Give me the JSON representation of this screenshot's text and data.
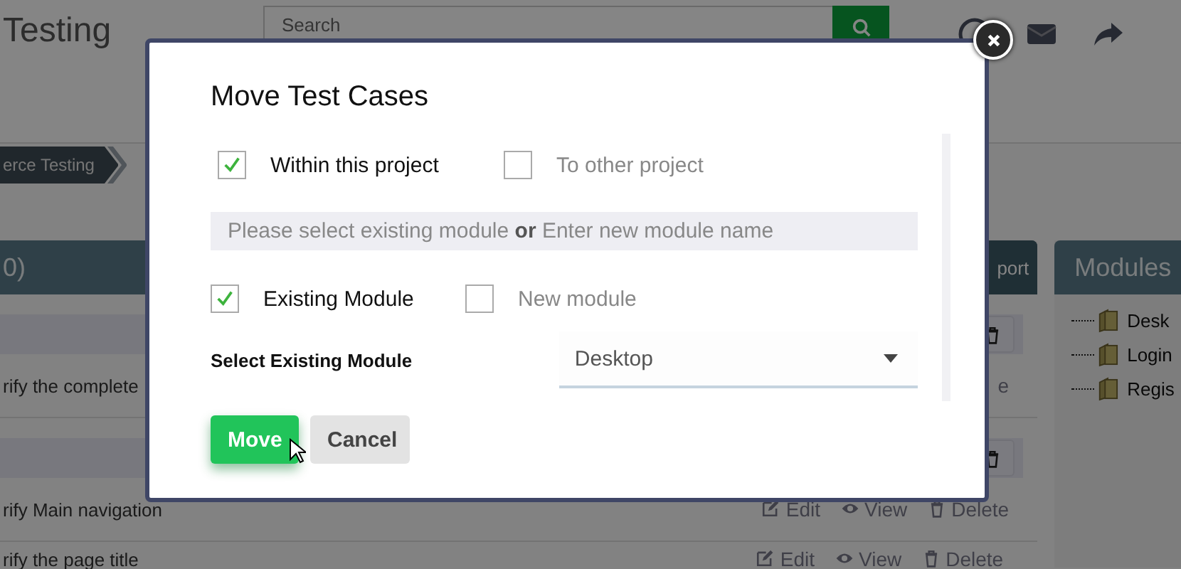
{
  "header": {
    "title": "Testing",
    "search": {
      "placeholder": "Search"
    }
  },
  "breadcrumb": [
    {
      "label": "erce Testing",
      "selected": true
    }
  ],
  "cases_panel": {
    "title": "0)",
    "button": "port",
    "rows": [
      {
        "kind": "group"
      },
      {
        "kind": "case",
        "text": "rify the complete",
        "actions": [
          {
            "kind": "delete",
            "label": "e"
          }
        ]
      },
      {
        "kind": "group"
      },
      {
        "kind": "case",
        "text": "rify Main navigation",
        "actions": [
          {
            "kind": "edit",
            "label": "Edit"
          },
          {
            "kind": "view",
            "label": "View"
          },
          {
            "kind": "delete",
            "label": "Delete"
          }
        ]
      },
      {
        "kind": "case",
        "text": "rify the page title",
        "actions": [
          {
            "kind": "edit",
            "label": "Edit"
          },
          {
            "kind": "view",
            "label": "View"
          },
          {
            "kind": "delete",
            "label": "Delete"
          }
        ]
      }
    ]
  },
  "modules_panel": {
    "title": "Modules",
    "items": [
      "Desk",
      "Login",
      "Regis"
    ]
  },
  "dialog": {
    "title": "Move Test Cases",
    "scope_options": [
      {
        "label": "Within this project",
        "checked": true
      },
      {
        "label": "To other project",
        "checked": false
      }
    ],
    "hint": "Please select existing module **or** Enter new module name",
    "module_options": [
      {
        "label": "Existing Module",
        "checked": true
      },
      {
        "label": "New module",
        "checked": false
      }
    ],
    "select_label": "Select Existing Module",
    "select_value": "Desktop",
    "buttons": [
      {
        "label": "Move",
        "kind": "primary"
      },
      {
        "label": "Cancel",
        "kind": "secondary"
      }
    ]
  }
}
